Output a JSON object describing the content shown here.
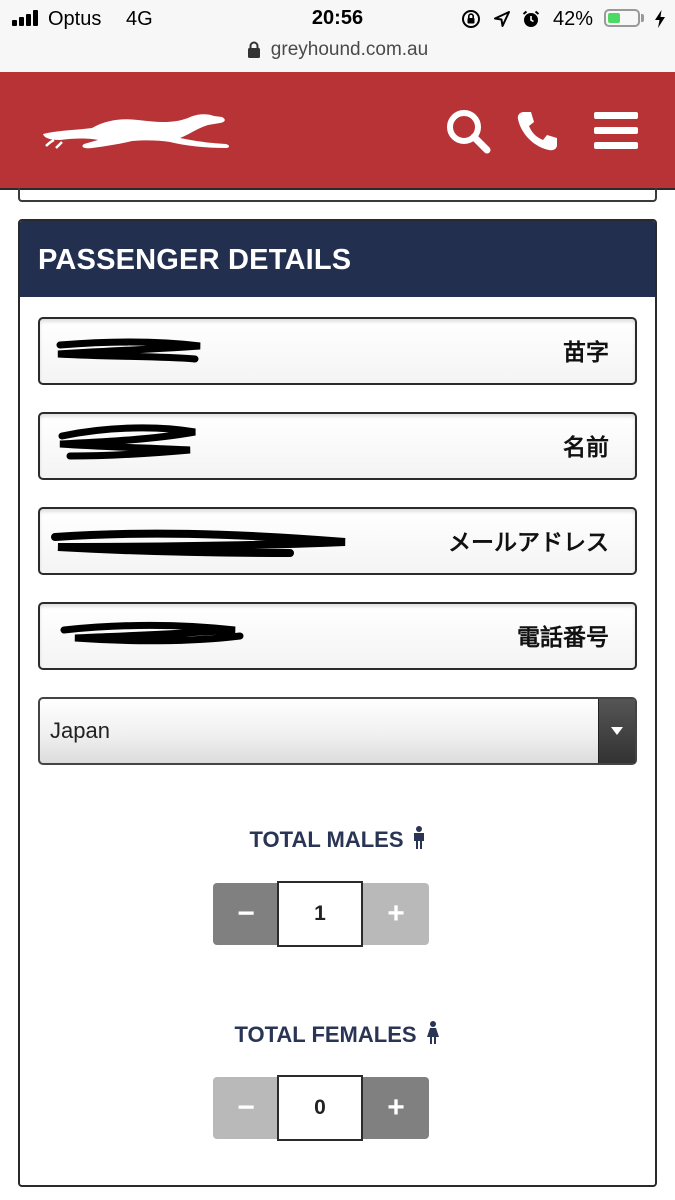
{
  "status_bar": {
    "carrier": "Optus",
    "network": "4G",
    "time": "20:56",
    "battery_percent": "42%",
    "battery_level": 0.42,
    "icons": [
      "signal-icon",
      "orientation-lock-icon",
      "location-arrow-icon",
      "alarm-icon",
      "battery-icon",
      "charging-bolt-icon"
    ]
  },
  "browser": {
    "url": "greyhound.com.au",
    "icons": [
      "lock-icon"
    ]
  },
  "header": {
    "brand_color": "#b83336",
    "icons": [
      "greyhound-logo",
      "search-icon",
      "phone-icon",
      "hamburger-menu-icon"
    ]
  },
  "passenger_details": {
    "title": "PASSENGER DETAILS",
    "header_color": "#232f4f",
    "fields": [
      {
        "label": "苗字",
        "value": ""
      },
      {
        "label": "名前",
        "value": ""
      },
      {
        "label": "メールアドレス",
        "value": ""
      },
      {
        "label": "電話番号",
        "value": ""
      }
    ],
    "country": {
      "value": "Japan",
      "icons": [
        "dropdown-arrow-icon"
      ]
    },
    "males": {
      "label": "TOTAL MALES",
      "value": "1",
      "minus": "−",
      "plus": "+",
      "icons": [
        "male-person-icon"
      ]
    },
    "females": {
      "label": "TOTAL FEMALES",
      "value": "0",
      "minus": "−",
      "plus": "+",
      "icons": [
        "female-person-icon"
      ]
    }
  }
}
